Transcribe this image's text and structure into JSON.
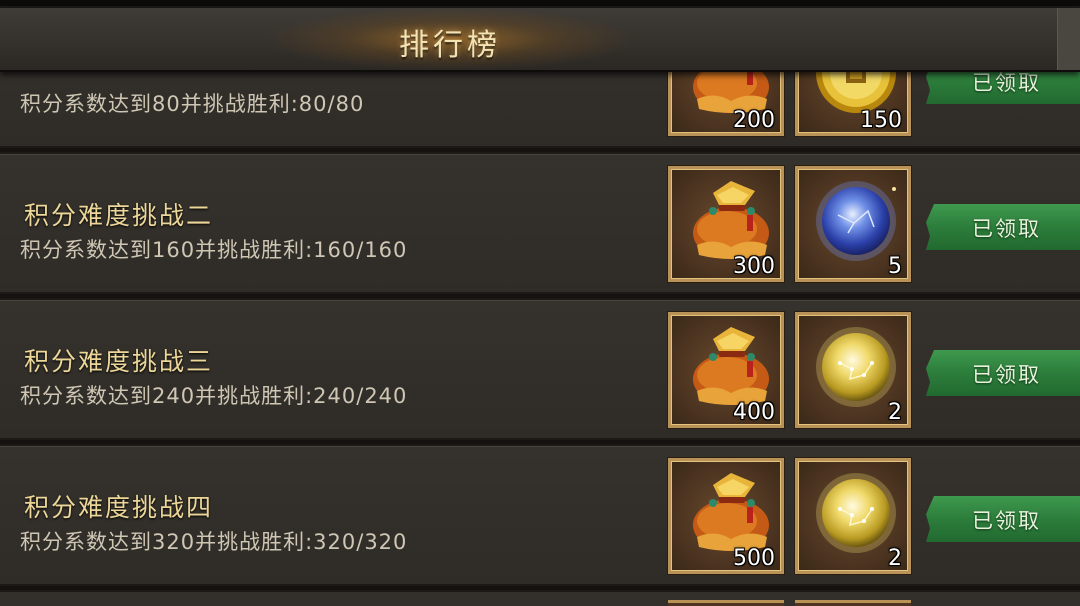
{
  "header": {
    "title": "排行榜"
  },
  "rows": [
    {
      "title": "",
      "desc": "积分系数达到80并挑战胜利:80/80",
      "rewards": [
        {
          "icon": "lucky-bag-icon",
          "count": "200"
        },
        {
          "icon": "gold-coin-icon",
          "count": "150"
        }
      ],
      "button": "已领取"
    },
    {
      "title": "积分难度挑战二",
      "desc": "积分系数达到160并挑战胜利:160/160",
      "rewards": [
        {
          "icon": "lucky-bag-icon",
          "count": "300"
        },
        {
          "icon": "blue-orb-icon",
          "count": "5"
        }
      ],
      "button": "已领取"
    },
    {
      "title": "积分难度挑战三",
      "desc": "积分系数达到240并挑战胜利:240/240",
      "rewards": [
        {
          "icon": "lucky-bag-icon",
          "count": "400"
        },
        {
          "icon": "gold-orb-icon",
          "count": "2"
        }
      ],
      "button": "已领取"
    },
    {
      "title": "积分难度挑战四",
      "desc": "积分系数达到320并挑战胜利:320/320",
      "rewards": [
        {
          "icon": "lucky-bag-icon",
          "count": "500"
        },
        {
          "icon": "gold-orb-icon",
          "count": "2"
        }
      ],
      "button": "已领取"
    }
  ],
  "colors": {
    "title_gold": "#ecd698",
    "button_green": "#2c7d3b",
    "slot_border": "#b99257"
  }
}
